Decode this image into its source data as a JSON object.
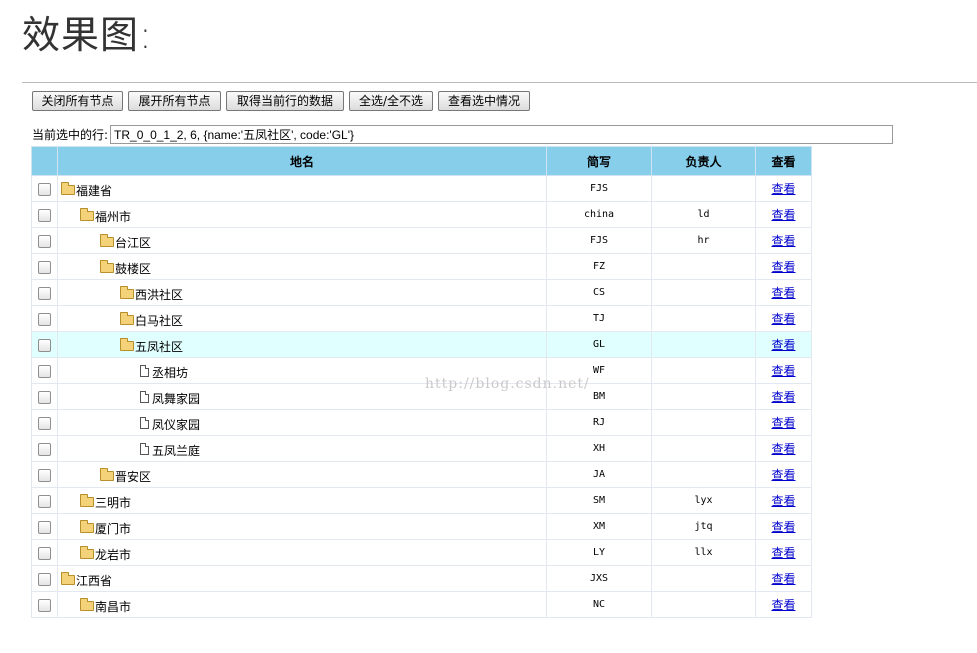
{
  "page": {
    "heading": "效果图:"
  },
  "toolbar": {
    "collapse_all": "关闭所有节点",
    "expand_all": "展开所有节点",
    "get_current": "取得当前行的数据",
    "toggle_all": "全选/全不选",
    "view_checked": "查看选中情况"
  },
  "current": {
    "label": "当前选中的行:",
    "value": "TR_0_0_1_2, 6, {name:'五凤社区', code:'GL'}"
  },
  "table": {
    "headers": [
      "地名",
      "简写",
      "负责人",
      "查看"
    ],
    "rows": [
      {
        "name": "福建省",
        "code": "FJS",
        "owner": "",
        "view": "查看",
        "level": 0,
        "type": "folder"
      },
      {
        "name": "福州市",
        "code": "china",
        "owner": "ld",
        "view": "查看",
        "level": 1,
        "type": "folder"
      },
      {
        "name": "台江区",
        "code": "FJS",
        "owner": "hr",
        "view": "查看",
        "level": 2,
        "type": "folder"
      },
      {
        "name": "鼓楼区",
        "code": "FZ",
        "owner": "",
        "view": "查看",
        "level": 2,
        "type": "folder"
      },
      {
        "name": "西洪社区",
        "code": "CS",
        "owner": "",
        "view": "查看",
        "level": 3,
        "type": "folder"
      },
      {
        "name": "白马社区",
        "code": "TJ",
        "owner": "",
        "view": "查看",
        "level": 3,
        "type": "folder"
      },
      {
        "name": "五凤社区",
        "code": "GL",
        "owner": "",
        "view": "查看",
        "level": 3,
        "type": "folder",
        "selected": true
      },
      {
        "name": "丞相坊",
        "code": "WF",
        "owner": "",
        "view": "查看",
        "level": 4,
        "type": "file"
      },
      {
        "name": "凤舞家园",
        "code": "BM",
        "owner": "",
        "view": "查看",
        "level": 4,
        "type": "file"
      },
      {
        "name": "凤仪家园",
        "code": "RJ",
        "owner": "",
        "view": "查看",
        "level": 4,
        "type": "file"
      },
      {
        "name": "五凤兰庭",
        "code": "XH",
        "owner": "",
        "view": "查看",
        "level": 4,
        "type": "file"
      },
      {
        "name": "晋安区",
        "code": "JA",
        "owner": "",
        "view": "查看",
        "level": 2,
        "type": "folder"
      },
      {
        "name": "三明市",
        "code": "SM",
        "owner": "lyx",
        "view": "查看",
        "level": 1,
        "type": "folder"
      },
      {
        "name": "厦门市",
        "code": "XM",
        "owner": "jtq",
        "view": "查看",
        "level": 1,
        "type": "folder"
      },
      {
        "name": "龙岩市",
        "code": "LY",
        "owner": "llx",
        "view": "查看",
        "level": 1,
        "type": "folder"
      },
      {
        "name": "江西省",
        "code": "JXS",
        "owner": "",
        "view": "查看",
        "level": 0,
        "type": "folder"
      },
      {
        "name": "南昌市",
        "code": "NC",
        "owner": "",
        "view": "查看",
        "level": 1,
        "type": "folder"
      }
    ]
  },
  "watermark": "http://blog.csdn.net/"
}
